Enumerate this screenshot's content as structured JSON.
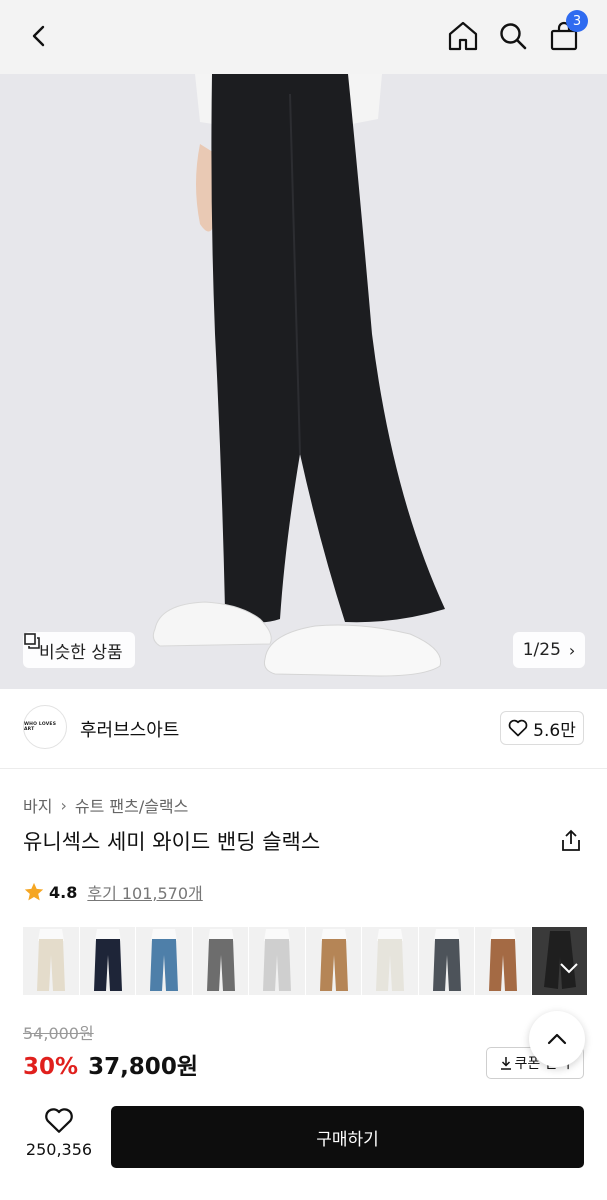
{
  "header": {
    "back_icon": "chevron-left-icon",
    "home_icon": "home-icon",
    "search_icon": "search-icon",
    "cart_icon": "shopping-bag-icon",
    "cart_count": "3"
  },
  "gallery": {
    "similar_label": "비슷한 상품",
    "counter": "1/25"
  },
  "brand": {
    "name": "후러브스아트",
    "logo_text": "WHO LOVES ART",
    "likes": "5.6만"
  },
  "breadcrumb": {
    "category": "바지",
    "subcategory": "슈트 팬츠/슬랙스"
  },
  "product": {
    "title": "유니섹스 세미 와이드 밴딩 슬랙스",
    "rating": "4.8",
    "reviews": "후기 101,570개",
    "original_price": "54,000원",
    "discount": "30%",
    "sale_price": "37,800원",
    "coupon_label": "쿠폰 받기",
    "swatch_colors": [
      "#e4dccb",
      "#1e2538",
      "#4e7fa9",
      "#6d6d6d",
      "#cfcfcf",
      "#b58556",
      "#e6e4dc",
      "#4d535a",
      "#a46a44",
      "#1f1f1f"
    ]
  },
  "bottom_bar": {
    "wish_count": "250,356",
    "buy_label": "구매하기"
  },
  "colors": {
    "accent_badge": "#2f6bf0",
    "discount": "#e0201d",
    "star": "#f5a623",
    "buy_button": "#0d0d0d"
  }
}
